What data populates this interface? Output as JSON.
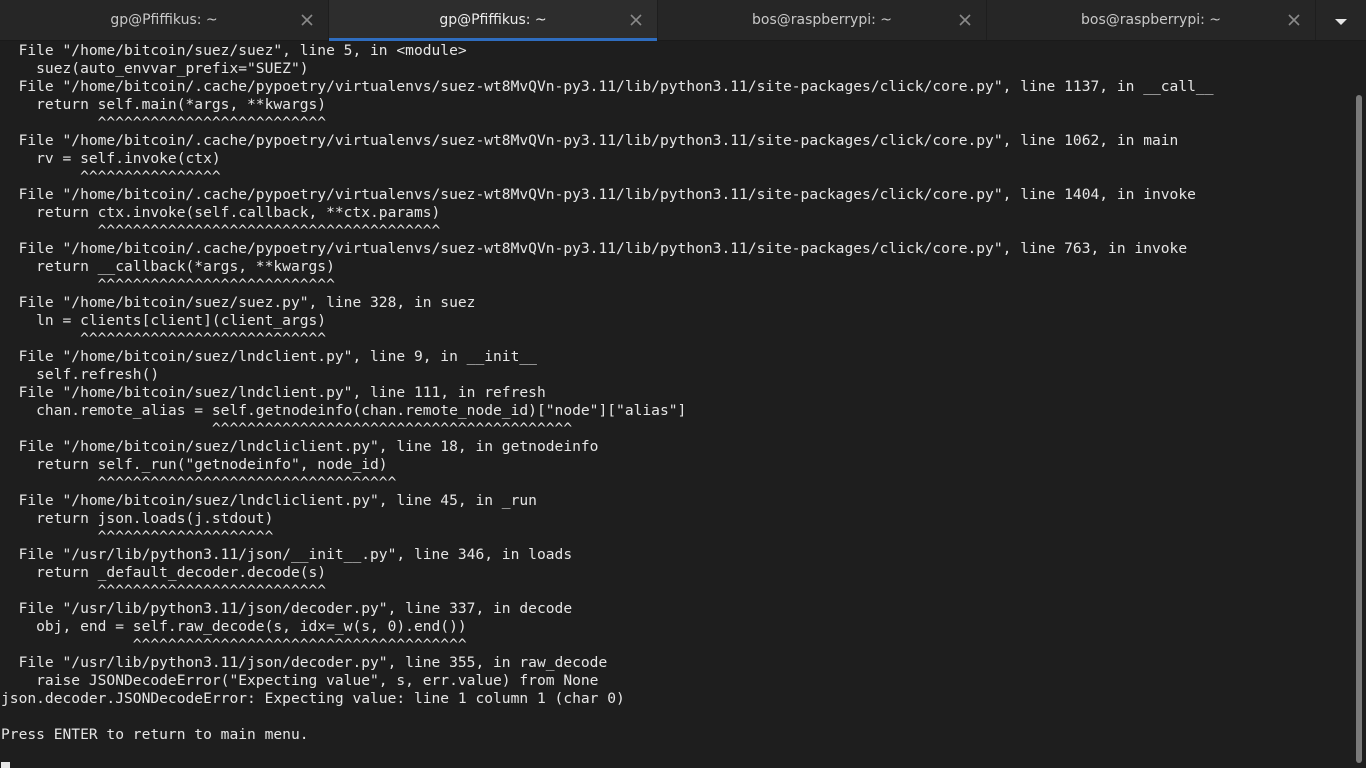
{
  "tabs": [
    {
      "label": "gp@Pfiffikus: ~",
      "active": false
    },
    {
      "label": "gp@Pfiffikus: ~",
      "active": true
    },
    {
      "label": "bos@raspberrypi: ~",
      "active": false
    },
    {
      "label": "bos@raspberrypi: ~",
      "active": false
    }
  ],
  "terminal": {
    "lines": [
      "  File \"/home/bitcoin/suez/suez\", line 5, in <module>",
      "    suez(auto_envvar_prefix=\"SUEZ\")",
      "  File \"/home/bitcoin/.cache/pypoetry/virtualenvs/suez-wt8MvQVn-py3.11/lib/python3.11/site-packages/click/core.py\", line 1137, in __call__",
      "    return self.main(*args, **kwargs)",
      "           ^^^^^^^^^^^^^^^^^^^^^^^^^^",
      "  File \"/home/bitcoin/.cache/pypoetry/virtualenvs/suez-wt8MvQVn-py3.11/lib/python3.11/site-packages/click/core.py\", line 1062, in main",
      "    rv = self.invoke(ctx)",
      "         ^^^^^^^^^^^^^^^^",
      "  File \"/home/bitcoin/.cache/pypoetry/virtualenvs/suez-wt8MvQVn-py3.11/lib/python3.11/site-packages/click/core.py\", line 1404, in invoke",
      "    return ctx.invoke(self.callback, **ctx.params)",
      "           ^^^^^^^^^^^^^^^^^^^^^^^^^^^^^^^^^^^^^^^",
      "  File \"/home/bitcoin/.cache/pypoetry/virtualenvs/suez-wt8MvQVn-py3.11/lib/python3.11/site-packages/click/core.py\", line 763, in invoke",
      "    return __callback(*args, **kwargs)",
      "           ^^^^^^^^^^^^^^^^^^^^^^^^^^^",
      "  File \"/home/bitcoin/suez/suez.py\", line 328, in suez",
      "    ln = clients[client](client_args)",
      "         ^^^^^^^^^^^^^^^^^^^^^^^^^^^^",
      "  File \"/home/bitcoin/suez/lndclient.py\", line 9, in __init__",
      "    self.refresh()",
      "  File \"/home/bitcoin/suez/lndclient.py\", line 111, in refresh",
      "    chan.remote_alias = self.getnodeinfo(chan.remote_node_id)[\"node\"][\"alias\"]",
      "                        ^^^^^^^^^^^^^^^^^^^^^^^^^^^^^^^^^^^^^^^^^",
      "  File \"/home/bitcoin/suez/lndcliclient.py\", line 18, in getnodeinfo",
      "    return self._run(\"getnodeinfo\", node_id)",
      "           ^^^^^^^^^^^^^^^^^^^^^^^^^^^^^^^^^^",
      "  File \"/home/bitcoin/suez/lndcliclient.py\", line 45, in _run",
      "    return json.loads(j.stdout)",
      "           ^^^^^^^^^^^^^^^^^^^^",
      "  File \"/usr/lib/python3.11/json/__init__.py\", line 346, in loads",
      "    return _default_decoder.decode(s)",
      "           ^^^^^^^^^^^^^^^^^^^^^^^^^^",
      "  File \"/usr/lib/python3.11/json/decoder.py\", line 337, in decode",
      "    obj, end = self.raw_decode(s, idx=_w(s, 0).end())",
      "               ^^^^^^^^^^^^^^^^^^^^^^^^^^^^^^^^^^^^^^",
      "  File \"/usr/lib/python3.11/json/decoder.py\", line 355, in raw_decode",
      "    raise JSONDecodeError(\"Expecting value\", s, err.value) from None",
      "json.decoder.JSONDecodeError: Expecting value: line 1 column 1 (char 0)",
      "",
      "Press ENTER to return to main menu."
    ]
  },
  "colors": {
    "background": "#1e1e1e",
    "text": "#e6e6e6",
    "tab_accent": "#2f6dbf"
  },
  "icons": {
    "tab_close": "close-icon",
    "tab_menu": "chevron-down-icon"
  }
}
